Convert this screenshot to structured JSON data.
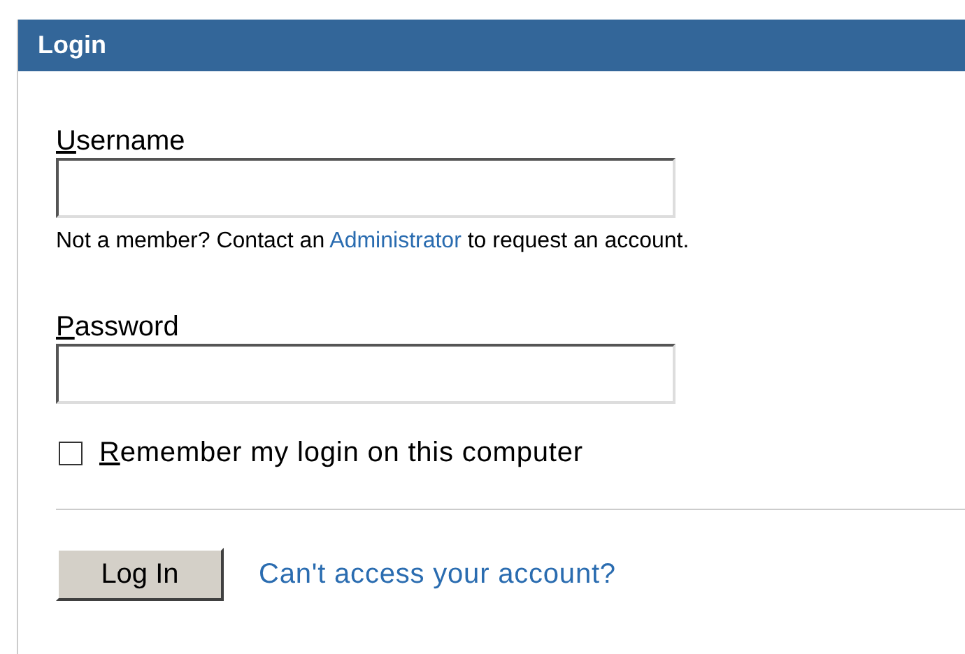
{
  "panel": {
    "title": "Login"
  },
  "username": {
    "label": "Username"
  },
  "help": {
    "before": "Not a member? Contact an ",
    "link": "Administrator",
    "after": " to request an account."
  },
  "password": {
    "label": "Password"
  },
  "remember": {
    "label": "Remember my login on this computer",
    "checked": false
  },
  "buttons": [
    {
      "label": "Log In"
    }
  ],
  "links": [
    {
      "label": "Can't access your account?"
    }
  ]
}
